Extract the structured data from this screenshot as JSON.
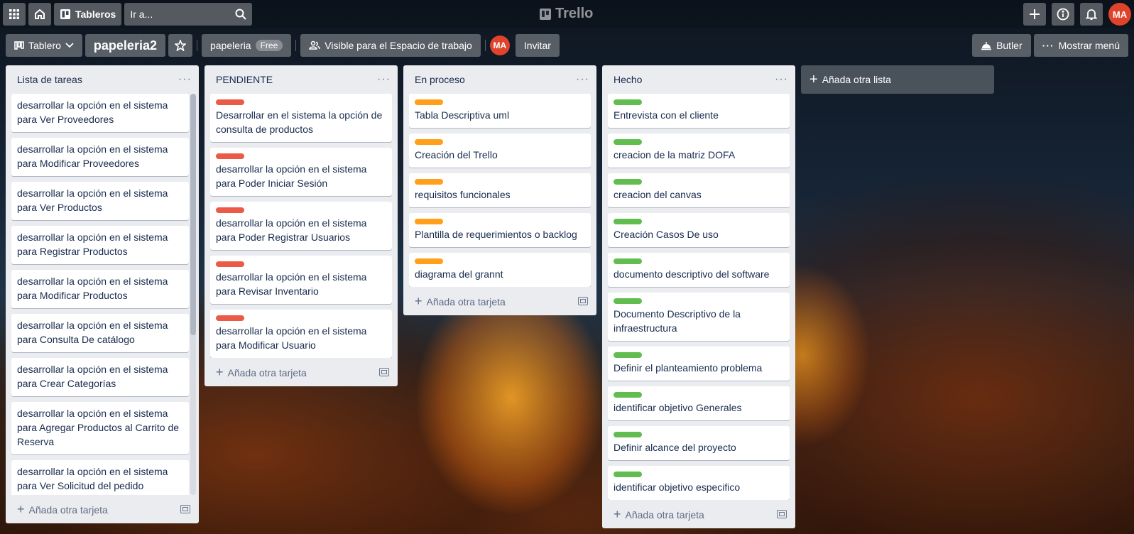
{
  "topbar": {
    "boards_label": "Tableros",
    "search_placeholder": "Ir a...",
    "logo_text": "Trello",
    "avatar_initials": "MA"
  },
  "board": {
    "view_label": "Tablero",
    "title": "papeleria2",
    "workspace_name": "papeleria",
    "workspace_badge": "Free",
    "visibility_label": "Visible para el Espacio de trabajo",
    "member_initials": "MA",
    "invite_label": "Invitar",
    "butler_label": "Butler",
    "menu_label": "Mostrar menú"
  },
  "colors": {
    "red_label": "#eb5a46",
    "orange_label": "#ff9f1a",
    "green_label": "#61bd4f",
    "avatar": "#e0432c"
  },
  "lists": [
    {
      "title": "Lista de tareas",
      "add_card": "Añada otra tarjeta",
      "cards": [
        {
          "text": "desarrollar la opción en el sistema para Ver Proveedores"
        },
        {
          "text": "desarrollar la opción en el sistema para Modificar Proveedores"
        },
        {
          "text": "desarrollar la opción en el sistema para Ver Productos"
        },
        {
          "text": "desarrollar la opción en el sistema para Registrar Productos"
        },
        {
          "text": "desarrollar la opción en el sistema para Modificar Productos"
        },
        {
          "text": "desarrollar la opción en el sistema para Consulta De catálogo"
        },
        {
          "text": "desarrollar la opción en el sistema para Crear Categorías"
        },
        {
          "text": "desarrollar la opción en el sistema para Agregar Productos al Carrito de Reserva"
        },
        {
          "text": "desarrollar la opción en el sistema para Ver Solicitud del pedido"
        }
      ]
    },
    {
      "title": "PENDIENTE",
      "add_card": "Añada otra tarjeta",
      "label_color": "red",
      "cards": [
        {
          "text": "Desarrollar en el sistema la opción de consulta de productos"
        },
        {
          "text": "desarrollar la opción en el sistema para Poder Iniciar Sesión"
        },
        {
          "text": "desarrollar la opción en el sistema para Poder Registrar Usuarios"
        },
        {
          "text": "desarrollar la opción en el sistema para Revisar Inventario"
        },
        {
          "text": "desarrollar la opción en el sistema para Modificar Usuario"
        }
      ]
    },
    {
      "title": "En proceso",
      "add_card": "Añada otra tarjeta",
      "label_color": "orange",
      "cards": [
        {
          "text": "Tabla Descriptiva uml"
        },
        {
          "text": "Creación del Trello"
        },
        {
          "text": "requisitos funcionales"
        },
        {
          "text": "Plantilla de requerimientos o backlog"
        },
        {
          "text": "diagrama del grannt"
        }
      ]
    },
    {
      "title": "Hecho",
      "add_card": "Añada otra tarjeta",
      "label_color": "green",
      "cards": [
        {
          "text": "Entrevista con el cliente"
        },
        {
          "text": "creacion de la matriz DOFA"
        },
        {
          "text": "creacion del canvas"
        },
        {
          "text": "Creación Casos De uso"
        },
        {
          "text": "documento descriptivo del software"
        },
        {
          "text": "Documento Descriptivo de la infraestructura"
        },
        {
          "text": "Definir el planteamiento problema"
        },
        {
          "text": "identificar objetivo Generales"
        },
        {
          "text": "Definir alcance del proyecto"
        },
        {
          "text": "identificar objetivo especifico"
        }
      ]
    }
  ],
  "add_list_label": "Añada otra lista"
}
